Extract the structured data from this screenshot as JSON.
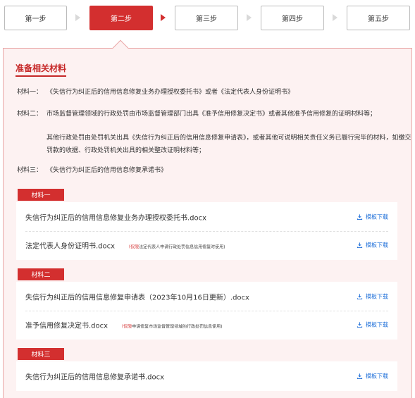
{
  "steps": [
    {
      "label": "第一步",
      "active": false
    },
    {
      "label": "第二步",
      "active": true
    },
    {
      "label": "第三步",
      "active": false
    },
    {
      "label": "第四步",
      "active": false
    },
    {
      "label": "第五步",
      "active": false
    }
  ],
  "panel": {
    "title": "准备相关材料",
    "materials": [
      {
        "label": "材料一：",
        "text": "《失信行为纠正后的信用信息修复业务办理授权委托书》或者《法定代表人身份证明书》"
      },
      {
        "label": "材料二：",
        "lines": [
          "市场监督管理领域的行政处罚由市场监督管理部门出具《准予信用修复决定书》或者其他准予信用修复的证明材料等；",
          "其他行政处罚由处罚机关出具《失信行为纠正后的信用信息修复申请表》，或者其他可说明相关责任义务已履行完毕的材料，如缴交罚款的收据、行政处罚机关出具的相关整改证明材料等；"
        ]
      },
      {
        "label": "材料三：",
        "text": "《失信行为纠正后的信用信息修复承诺书》"
      }
    ]
  },
  "download_label": "模板下载",
  "groups": [
    {
      "tag": "材料一",
      "files": [
        {
          "name": "失信行为纠正后的信用信息修复业务办理授权委托书.docx",
          "note_red": "",
          "note": ""
        },
        {
          "name": "法定代表人身份证明书.docx",
          "note_red": "（仅限",
          "note": "法定代表人申请行政处罚信息信用修复时使用)"
        }
      ]
    },
    {
      "tag": "材料二",
      "files": [
        {
          "name": "失信行为纠正后的信用信息修复申请表（2023年10月16日更新）.docx",
          "note_red": "",
          "note": ""
        },
        {
          "name": "准予信用修复决定书.docx",
          "note_red": "（仅限",
          "note": "申请修复市场监督管理领域的行政处罚信息使用)"
        }
      ]
    },
    {
      "tag": "材料三",
      "files": [
        {
          "name": "失信行为纠正后的信用信息修复承诺书.docx",
          "note_red": "",
          "note": ""
        }
      ]
    }
  ],
  "colors": {
    "accent": "#d32f2f",
    "panel_bg": "#fdf2f2",
    "link": "#1e6fd9"
  },
  "icons": {
    "download": "download-icon"
  }
}
